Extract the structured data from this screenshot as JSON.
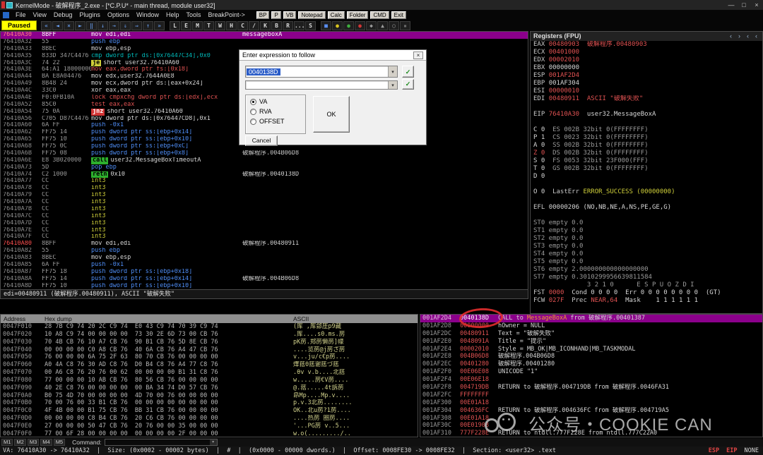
{
  "window": {
    "title": "KernelMode - 破解程序_2.exe - [*C.P.U* - main thread, module user32]",
    "controls": [
      {
        "name": "minimize-button",
        "glyph": "—"
      },
      {
        "name": "maximize-button",
        "glyph": "□"
      },
      {
        "name": "close-button",
        "glyph": "×"
      }
    ]
  },
  "menu": {
    "items": [
      "File",
      "View",
      "Debug",
      "Plugins",
      "Options",
      "Window",
      "Help",
      "Tools",
      "BreakPoint->"
    ],
    "quick_buttons": [
      "BP",
      "P",
      "VB",
      "Notepad",
      "Calc",
      "Folder",
      "CMD",
      "Exit"
    ]
  },
  "toolbar": {
    "state_label": "Paused",
    "icons": [
      {
        "name": "restart-icon",
        "glyph": "«"
      },
      {
        "name": "step-back-icon",
        "glyph": "◄"
      },
      {
        "name": "close-program-icon",
        "glyph": "×"
      },
      {
        "name": "run-icon",
        "glyph": "►"
      },
      {
        "name": "pause-icon",
        "glyph": "‖"
      },
      {
        "name": "step-into-icon",
        "glyph": "↓"
      },
      {
        "name": "step-over-icon",
        "glyph": "→"
      },
      {
        "name": "trace-into-icon",
        "glyph": "⇓"
      },
      {
        "name": "trace-over-icon",
        "glyph": "⇒"
      },
      {
        "name": "until-return-icon",
        "glyph": "↑"
      },
      {
        "name": "goto-address-icon",
        "glyph": "»"
      }
    ],
    "window_buttons": [
      "L",
      "E",
      "M",
      "T",
      "W",
      "H",
      "C",
      "/",
      "K",
      "B",
      "R",
      "...",
      "S"
    ],
    "extra_icons": [
      {
        "name": "memory-map-icon",
        "glyph": "■",
        "color": "#5a8ef0"
      },
      {
        "name": "log-icon",
        "glyph": "●",
        "color": "#d9c51f"
      },
      {
        "name": "run-trace-icon",
        "glyph": "●",
        "color": "#3fae3f"
      },
      {
        "name": "breakpoint-list-icon",
        "glyph": "●",
        "color": "#d23535"
      },
      {
        "name": "windows-list-icon",
        "glyph": "◆",
        "color": "#9a9a9a"
      },
      {
        "name": "handles-icon",
        "glyph": "▲",
        "color": "#9a9a9a"
      },
      {
        "name": "patches-icon",
        "glyph": "○",
        "color": "#9a9a9a"
      },
      {
        "name": "cpu-icon",
        "glyph": "▪",
        "color": "#6a6a6a"
      }
    ]
  },
  "disasm": {
    "info_line": "edi=00480911 (破解程序.00480911), ASCII \"破解失败\"",
    "rows": [
      {
        "a": "76410A30",
        "ar": true,
        "b": "8BFF",
        "i": "mov edi,edi",
        "k": "wht",
        "c": "messageboxA",
        "sel": true
      },
      {
        "a": "76410A32",
        "b": "55",
        "i": "push ebp",
        "k": "blu"
      },
      {
        "a": "76410A33",
        "b": "8BEC",
        "i": "mov ebp,esp",
        "k": "wht"
      },
      {
        "a": "76410A35",
        "b": "833D 347C4476",
        "i": "cmp dword ptr ds:[0x76447C34],0x0",
        "k": "cyn"
      },
      {
        "a": "76410A3C",
        "b": "74 22",
        "chip": "je",
        "chipc": "y",
        "i": "short user32.76410A60",
        "k": "wht"
      },
      {
        "a": "76410A3E",
        "b": "64:A1 18000000",
        "i": "mov eax,dword ptr fs:[0x18]",
        "k": "red"
      },
      {
        "a": "76410A44",
        "b": "BA E8A04476",
        "i": "mov edx,user32.7644A0E8",
        "k": "wht"
      },
      {
        "a": "76410A49",
        "b": "8B48 24",
        "i": "mov ecx,dword ptr ds:[eax+0x24]",
        "k": "wht"
      },
      {
        "a": "76410A4C",
        "b": "33C0",
        "i": "xor eax,eax",
        "k": "wht"
      },
      {
        "a": "76410A4E",
        "b": "F0:0FB10A",
        "i": "lock cmpxchg dword ptr ds:[edx],ecx",
        "k": "red"
      },
      {
        "a": "76410A52",
        "b": "85C0",
        "i": "test eax,eax",
        "k": "red"
      },
      {
        "a": "76410A54",
        "b": "75 0A",
        "chip": "jnz",
        "chipc": "r",
        "i": "short user32.76410A60",
        "k": "wht"
      },
      {
        "a": "76410A56",
        "b": "C705 D87C4476",
        "i": "mov dword ptr ds:[0x76447CD8],0x1",
        "k": "wht"
      },
      {
        "a": "76410A60",
        "b": "6A FF",
        "i": "push -0x1",
        "k": "blu"
      },
      {
        "a": "76410A62",
        "b": "FF75 14",
        "i": "push dword ptr ss:[ebp+0x14]",
        "k": "blu"
      },
      {
        "a": "76410A65",
        "b": "FF75 10",
        "i": "push dword ptr ss:[ebp+0x10]",
        "k": "blu"
      },
      {
        "a": "76410A68",
        "b": "FF75 0C",
        "i": "push dword ptr ss:[ebp+0xC]",
        "k": "blu"
      },
      {
        "a": "76410A6B",
        "b": "FF75 08",
        "i": "push dword ptr ss:[ebp+0x8]",
        "k": "blu",
        "c": "破解程序.004B06D8"
      },
      {
        "a": "76410A6E",
        "b": "E8 3B020000",
        "chip": "call",
        "chipc": "g",
        "i": "user32.MessageBoxTimeoutA",
        "k": "wht"
      },
      {
        "a": "76410A73",
        "b": "5D",
        "i": "pop ebp",
        "k": "blu"
      },
      {
        "a": "76410A74",
        "b": "C2 1000",
        "chip": "retn",
        "chipc": "g",
        "i": "0x10",
        "k": "wht",
        "c": "破解程序.0040138D"
      },
      {
        "a": "76410A77",
        "b": "CC",
        "i": "int3",
        "k": "yel"
      },
      {
        "a": "76410A78",
        "b": "CC",
        "i": "int3",
        "k": "yel"
      },
      {
        "a": "76410A79",
        "b": "CC",
        "i": "int3",
        "k": "yel"
      },
      {
        "a": "76410A7A",
        "b": "CC",
        "i": "int3",
        "k": "yel"
      },
      {
        "a": "76410A7B",
        "b": "CC",
        "i": "int3",
        "k": "yel"
      },
      {
        "a": "76410A7C",
        "b": "CC",
        "i": "int3",
        "k": "yel"
      },
      {
        "a": "76410A7D",
        "b": "CC",
        "i": "int3",
        "k": "yel"
      },
      {
        "a": "76410A7E",
        "b": "CC",
        "i": "int3",
        "k": "yel"
      },
      {
        "a": "76410A7F",
        "b": "CC",
        "i": "int3",
        "k": "yel"
      },
      {
        "a": "76410A80",
        "ar": true,
        "b": "8BFF",
        "i": "mov edi,edi",
        "k": "wht",
        "c": "破解程序.00480911"
      },
      {
        "a": "76410A82",
        "b": "55",
        "i": "push ebp",
        "k": "blu"
      },
      {
        "a": "76410A83",
        "b": "8BEC",
        "i": "mov ebp,esp",
        "k": "wht"
      },
      {
        "a": "76410A85",
        "b": "6A FF",
        "i": "push -0x1",
        "k": "blu"
      },
      {
        "a": "76410A87",
        "b": "FF75 18",
        "i": "push dword ptr ss:[ebp+0x18]",
        "k": "blu"
      },
      {
        "a": "76410A8A",
        "b": "FF75 14",
        "i": "push dword ptr ss:[ebp+0x14]",
        "k": "blu",
        "c": "破解程序.004B06D8"
      },
      {
        "a": "76410A8D",
        "b": "FF75 10",
        "i": "push dword ptr ss:[ebp+0x10]",
        "k": "blu"
      }
    ]
  },
  "registers": {
    "header": "Registers (FPU)",
    "scroll_buttons": [
      {
        "name": "reg-scroll-left-icon",
        "glyph": "‹"
      },
      {
        "name": "reg-scroll-right-icon",
        "glyph": "›"
      },
      {
        "name": "reg-prev-icon",
        "glyph": "‹"
      },
      {
        "name": "reg-next-icon",
        "glyph": "‹"
      }
    ],
    "lines": [
      [
        [
          "EAX ",
          "lbl"
        ],
        [
          "00480903",
          "red"
        ],
        [
          "  破解程序.00480903",
          "red"
        ]
      ],
      [
        [
          "ECX ",
          "lbl"
        ],
        [
          "00401000",
          "red"
        ]
      ],
      [
        [
          "EDX ",
          "lbl"
        ],
        [
          "00002010",
          "red"
        ]
      ],
      [
        [
          "EBX ",
          "lbl"
        ],
        [
          "00000000",
          "wht"
        ]
      ],
      [
        [
          "ESP ",
          "lbl"
        ],
        [
          "001AF2D4",
          "red"
        ]
      ],
      [
        [
          "EBP ",
          "lbl"
        ],
        [
          "001AF304",
          "wht"
        ]
      ],
      [
        [
          "ESI ",
          "lbl"
        ],
        [
          "00000010",
          "red"
        ]
      ],
      [
        [
          "EDI ",
          "lbl"
        ],
        [
          "00480911",
          "red"
        ],
        [
          "  ASCII \"破解失败\"",
          "red"
        ]
      ],
      [],
      [
        [
          "EIP ",
          "lbl"
        ],
        [
          "76410A30",
          "red"
        ],
        [
          "  user32.MessageBoxA",
          "wht"
        ]
      ],
      [],
      [
        [
          "C 0  ",
          "wht"
        ],
        [
          "ES 002B 32bit 0(FFFFFFFF)",
          "gry"
        ]
      ],
      [
        [
          "P 1  ",
          "wht"
        ],
        [
          "CS 0023 32bit 0(FFFFFFFF)",
          "gry"
        ]
      ],
      [
        [
          "A 0  ",
          "wht"
        ],
        [
          "SS 002B 32bit 0(FFFFFFFF)",
          "gry"
        ]
      ],
      [
        [
          "Z 0  ",
          "red"
        ],
        [
          "DS 002B 32bit 0(FFFFFFFF)",
          "gry"
        ]
      ],
      [
        [
          "S 0  ",
          "wht"
        ],
        [
          "FS 0053 32bit 23F000(FFF)",
          "gry"
        ]
      ],
      [
        [
          "T 0  ",
          "wht"
        ],
        [
          "GS 002B 32bit 0(FFFFFFFF)",
          "gry"
        ]
      ],
      [
        [
          "D 0",
          "wht"
        ]
      ],
      [],
      [
        [
          "O 0  ",
          "wht"
        ],
        [
          "LastErr ",
          "lbl"
        ],
        [
          "ERROR_SUCCESS (00000000)",
          "yel"
        ]
      ],
      [],
      [
        [
          "EFL ",
          "lbl"
        ],
        [
          "00000206 (NO,NB,NE,A,NS,PE,GE,G)",
          "wht"
        ]
      ],
      [],
      [
        [
          "ST0 empty 0.0",
          "gry"
        ]
      ],
      [
        [
          "ST1 empty 0.0",
          "gry"
        ]
      ],
      [
        [
          "ST2 empty 0.0",
          "gry"
        ]
      ],
      [
        [
          "ST3 empty 0.0",
          "gry"
        ]
      ],
      [
        [
          "ST4 empty 0.0",
          "gry"
        ]
      ],
      [
        [
          "ST5 empty 0.0",
          "gry"
        ]
      ],
      [
        [
          "ST6 empty 2.000000000000000000",
          "gry"
        ]
      ],
      [
        [
          "ST7 empty 0.3010299956639811584",
          "gry"
        ]
      ],
      [
        [
          "              3 2 1 0      E S P U O Z D I",
          "gry"
        ]
      ],
      [
        [
          "FST ",
          "lbl"
        ],
        [
          "0000",
          "red"
        ],
        [
          "  Cond 0 0 0 0  Err 0 0 0 0 0 0 0 0  (GT)",
          "wht"
        ]
      ],
      [
        [
          "FCW ",
          "lbl"
        ],
        [
          "027F",
          "red"
        ],
        [
          "  Prec ",
          "lbl"
        ],
        [
          "NEAR,64",
          "red"
        ],
        [
          "  Mask    1 1 1 1 1 1",
          "wht"
        ]
      ]
    ]
  },
  "dump": {
    "headers": [
      "Address",
      "Hex dump",
      "ASCII"
    ],
    "rows": [
      {
        "a": "0047F010",
        "h": "28 7B C9 74 20 2C C9 74  E0 43 C9 74 70 39 C9 74",
        "s": "(厍 ,厍郐厓p9藏"
      },
      {
        "a": "0047F020",
        "h": "10 A8 C9 74 00 00 00 00  73 30 2E 6D 73 00 CB 76",
        "s": ".厍....s0.ms.苈"
      },
      {
        "a": "0047F030",
        "h": "70 4B CB 76 10 A7 CB 76  90 B1 CB 76 5D 8E CB 76",
        "s": "pK苈.郑苈懒苈]幪"
      },
      {
        "a": "0047F040",
        "h": "00 00 00 00 C0 A8 CB 76  40 6A CB 76 A4 47 CB 76",
        "s": "....览苈@j苈ざ苈"
      },
      {
        "a": "0047F050",
        "h": "76 00 00 00 6A 75 2F 63  80 70 CB 76 00 00 00 00",
        "s": "v...ju/c€p苈...."
      },
      {
        "a": "0047F060",
        "h": "A0 4A C8 76 30 AD C8 76  D0 B4 C8 76 A4 77 C8 76",
        "s": "燡葀0葀谢葀づ葀"
      },
      {
        "a": "0047F070",
        "h": "00 A6 C8 76 20 76 00 62  00 00 00 00 B1 31 C8 76",
        "s": ".θv v.b....北葀"
      },
      {
        "a": "0047F080",
        "h": "77 00 00 00 10 AB CB 76  80 56 CB 76 00 00 00 00",
        "s": "w.....苈€V苈...."
      },
      {
        "a": "0047F090",
        "h": "40 2E C8 76 00 00 00 00  00 BA 34 74 D0 57 CB 76",
        "s": "@.葀.....4t訴苈"
      },
      {
        "a": "0047F0A0",
        "h": "B0 75 4D 70 00 00 00 00  4D 70 00 76 00 00 00 00",
        "s": "皍Mp....Mp.v...."
      },
      {
        "a": "0047F0B0",
        "h": "70 00 76 00 33 B1 CB 76  00 00 00 00 00 00 00 00",
        "s": "p.v.3北苈........"
      },
      {
        "a": "0047F0C0",
        "h": "4F 4B 00 00 B1 75 CB 76  BB 31 CB 76 00 00 00 00",
        "s": "OK..北u苈?1苈...."
      },
      {
        "a": "0047F0D0",
        "h": "00 00 00 00 C8 B4 CB 76  20 C6 CB 76 00 00 00 00",
        "s": "....热苈 圈苈...."
      },
      {
        "a": "0047F0E0",
        "h": "27 00 00 00 50 47 CB 76  20 76 00 00 35 00 00 00",
        "s": "'...PG苈 v..5..."
      },
      {
        "a": "0047F0F0",
        "h": "77 00 6F 28 00 00 00 00  00 00 00 00 2F 00 00 00",
        "s": "w.o(........./.."
      }
    ]
  },
  "stack": {
    "rows": [
      {
        "a": "001AF2D4",
        "v": "0040138D",
        "sel": true,
        "parts": [
          [
            "CALL to ",
            "wht"
          ],
          [
            "MessageBoxA",
            "org"
          ],
          [
            " from 破解程序.00401387",
            "wht"
          ]
        ]
      },
      {
        "a": "001AF2D8",
        "v": "00000000",
        "parts": [
          [
            "hOwner = NULL",
            "wht"
          ]
        ]
      },
      {
        "a": "001AF2DC",
        "v": "00480911",
        "parts": [
          [
            "Text = \"破解失败\"",
            "wht"
          ]
        ]
      },
      {
        "a": "001AF2E0",
        "v": "0048091A",
        "parts": [
          [
            "Title = \"提示\"",
            "wht"
          ]
        ]
      },
      {
        "a": "001AF2E4",
        "v": "00002010",
        "parts": [
          [
            "Style = MB_OK|MB_ICONHAND|MB_TASKMODAL",
            "wht"
          ]
        ]
      },
      {
        "a": "001AF2E8",
        "v": "004B06D8",
        "parts": [
          [
            "破解程序.004B06D8",
            "wht"
          ]
        ]
      },
      {
        "a": "001AF2EC",
        "v": "00401280",
        "parts": [
          [
            "破解程序.00401280",
            "wht"
          ]
        ]
      },
      {
        "a": "001AF2F0",
        "v": "00E06E08",
        "parts": [
          [
            "UNICODE \"1\"",
            "wht"
          ]
        ]
      },
      {
        "a": "001AF2F4",
        "v": "00E06E18",
        "parts": []
      },
      {
        "a": "001AF2F8",
        "v": "004719DB",
        "parts": [
          [
            "RETURN to 破解程序.004719DB from 破解程序.0046FA31",
            "wht"
          ]
        ]
      },
      {
        "a": "001AF2FC",
        "v": "FFFFFFFF",
        "parts": []
      },
      {
        "a": "001AF300",
        "v": "00E01A18",
        "parts": []
      },
      {
        "a": "001AF304",
        "v": "004636FC",
        "parts": [
          [
            "RETURN to 破解程序.004636FC from 破解程序.004719A5",
            "wht"
          ]
        ]
      },
      {
        "a": "001AF308",
        "v": "00E01A18",
        "parts": []
      },
      {
        "a": "001AF30C",
        "v": "00E01908",
        "parts": []
      },
      {
        "a": "001AF310",
        "v": "777F228E",
        "parts": [
          [
            "RETURN to ntdll.777F228E from ntdll.777C22A0",
            "wht"
          ]
        ]
      }
    ]
  },
  "dialog": {
    "title": "Enter expression to follow",
    "close_glyph": "×",
    "expression": "0040138D",
    "history_value": "",
    "check_glyph": "✓",
    "radios": [
      "VA",
      "RVA",
      "OFFSET"
    ],
    "selected_radio": "VA",
    "ok_label": "OK",
    "cancel_label": "Cancel"
  },
  "status": {
    "mark_buttons": [
      "M1",
      "M2",
      "M3",
      "M4",
      "M5"
    ],
    "command_label": "Command:",
    "detail": "VA: 76410A30 -> 76410A32  |  Size: (0x0002 - 00002 bytes)  |  #  |  (0x0000 - 00000 dwords.)  |  Offset: 0008FE30 -> 0008FE32  |  Section: <user32> .text",
    "right": [
      {
        "label": "ESP",
        "accent": true
      },
      {
        "label": "EIP",
        "accent": true
      },
      {
        "label": "NONE",
        "accent": false
      }
    ]
  },
  "watermark": {
    "text": "公众号・COOKIE CAN"
  },
  "colors": {
    "selection": "#8b008b",
    "paused_bg": "#ffff00",
    "annotation": "#e12d2d"
  }
}
